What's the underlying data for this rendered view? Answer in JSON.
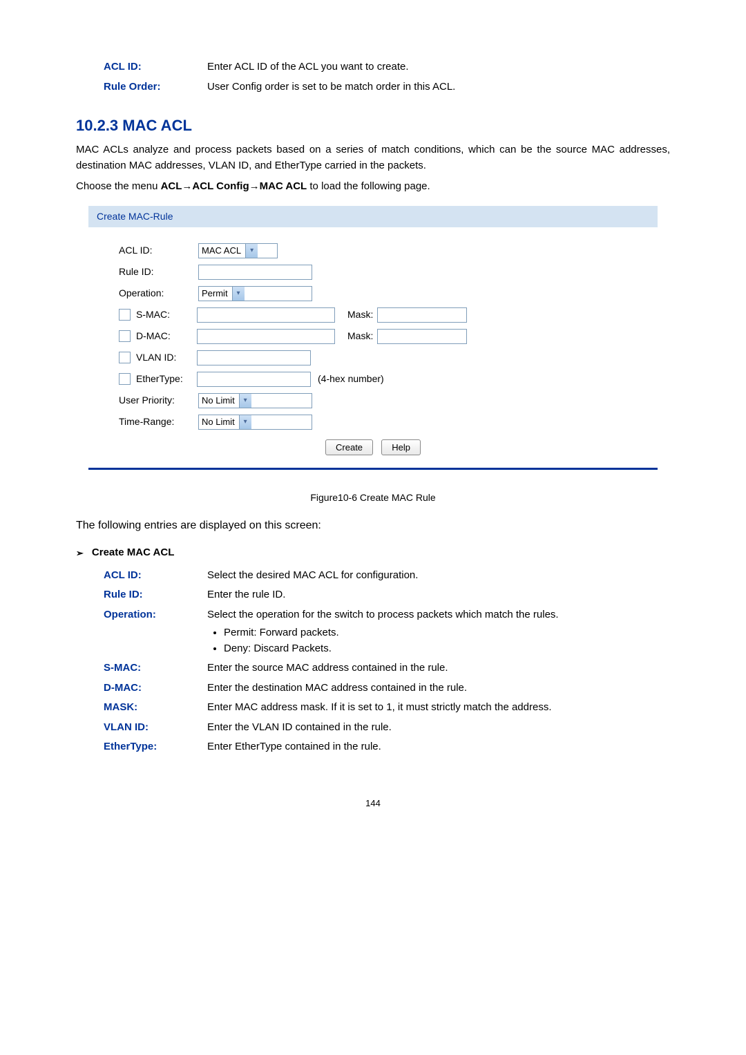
{
  "top_defs": {
    "acl_id": {
      "label": "ACL ID:",
      "desc": "Enter ACL ID of the ACL you want to create."
    },
    "rule_order": {
      "label": "Rule Order:",
      "desc": "User Config order is set to be match order in this ACL."
    }
  },
  "section": {
    "number_title": "10.2.3  MAC ACL",
    "intro": "MAC ACLs analyze and process packets based on a series of match conditions, which can be the source MAC addresses, destination MAC addresses, VLAN ID, and EtherType carried in the packets.",
    "menu_prefix": "Choose the menu ",
    "menu_bold": "ACL→ACL Config→MAC ACL",
    "menu_suffix": " to load the following page."
  },
  "form": {
    "panel_label": "Create MAC-Rule",
    "fields": {
      "acl_id": {
        "label": "ACL ID:",
        "select_text": "MAC ACL"
      },
      "rule_id": {
        "label": "Rule ID:"
      },
      "operation": {
        "label": "Operation:",
        "select_text": "Permit"
      },
      "smac": {
        "label": "S-MAC:",
        "mask_label": "Mask:"
      },
      "dmac": {
        "label": "D-MAC:",
        "mask_label": "Mask:"
      },
      "vlan_id": {
        "label": "VLAN ID:"
      },
      "ethertype": {
        "label": "EtherType:",
        "note": "(4-hex number)"
      },
      "user_priority": {
        "label": "User Priority:",
        "select_text": "No Limit"
      },
      "time_range": {
        "label": "Time-Range:",
        "select_text": "No Limit"
      }
    },
    "buttons": {
      "create": "Create",
      "help": "Help"
    }
  },
  "figure_caption": "Figure10-6 Create MAC Rule",
  "lead": "The following entries are displayed on this screen:",
  "subsection_title": "Create MAC ACL",
  "defs": {
    "acl_id": {
      "label": "ACL ID:",
      "desc": "Select the desired MAC ACL for configuration."
    },
    "rule_id": {
      "label": "Rule ID:",
      "desc": "Enter the rule ID."
    },
    "operation": {
      "label": "Operation:",
      "desc": "Select the operation for the switch to process packets which match the rules.",
      "bullets": [
        "Permit: Forward packets.",
        "Deny: Discard Packets."
      ]
    },
    "smac": {
      "label": "S-MAC:",
      "desc": "Enter the source MAC address contained in the rule."
    },
    "dmac": {
      "label": "D-MAC:",
      "desc": "Enter the destination MAC address contained in the rule."
    },
    "mask": {
      "label": "MASK:",
      "desc": "Enter MAC address mask. If it is set to 1, it must strictly match the address."
    },
    "vlan_id": {
      "label": "VLAN ID:",
      "desc": "Enter the VLAN ID contained in the rule."
    },
    "ethertype": {
      "label": "EtherType:",
      "desc": "Enter EtherType contained in the rule."
    }
  },
  "page_number": "144"
}
